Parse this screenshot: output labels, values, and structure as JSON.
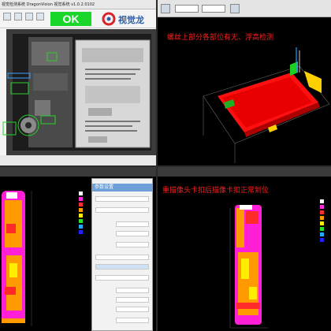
{
  "inspection": {
    "title": "视觉检测系统 DragonVision 视觉系统 v1.0.2.0102",
    "result": "OK",
    "brand": "视觉龙"
  },
  "view3d": {
    "label": "螺丝上部分各部位有无、浮高检测"
  },
  "heightmap": {
    "label": "重描像头卡扣后描像卡扣正常到位",
    "panel_header": "参数设置"
  },
  "colors": {
    "ok_green": "#19d62a",
    "annotation_red": "#ff2020",
    "heat_magenta": "#ff1fd6",
    "heat_orange": "#ff9a00",
    "heat_yellow": "#ffee00"
  },
  "legend_colors": [
    "#ffffff",
    "#ff2be0",
    "#ff3030",
    "#ff9a00",
    "#ffee00",
    "#2adf2a",
    "#22aaff",
    "#2222ff",
    "#000000"
  ]
}
